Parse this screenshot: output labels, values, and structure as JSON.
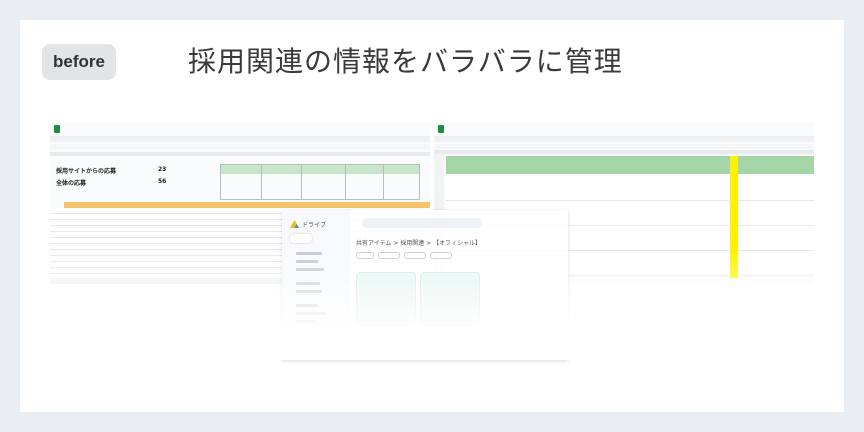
{
  "badge": {
    "label": "before"
  },
  "headline": {
    "text": "採用関連の情報をバラバラに管理"
  },
  "screenshots": {
    "left_sheet": {
      "kpi_rows": [
        {
          "label": "採用サイトからの応募",
          "value": "23"
        },
        {
          "label": "全体の応募",
          "value": "56"
        }
      ]
    },
    "drive": {
      "title": "ドライブ",
      "path": "共有アイテム > 採用関連 > 【オフィシャル】"
    }
  },
  "colors": {
    "background": "#e9eef4",
    "card": "#ffffff",
    "badge_bg": "#e3e4e6",
    "sheet_green": "#1e8e3e",
    "highlight_yellow": "#fff200",
    "header_orange": "#f6c26b",
    "header_green": "#a5d6a7"
  }
}
